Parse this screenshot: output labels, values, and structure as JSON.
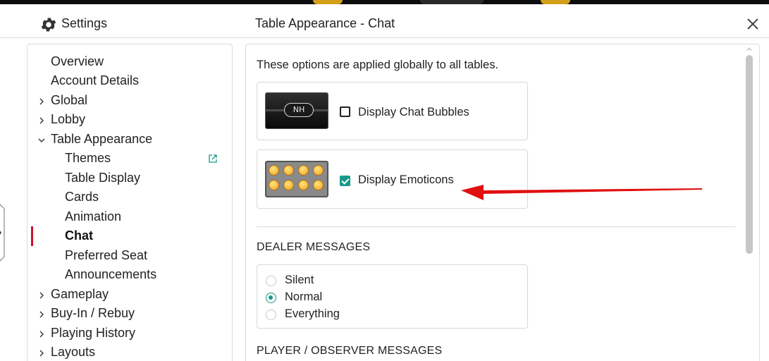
{
  "header": {
    "settings_label": "Settings",
    "page_title": "Table Appearance - Chat"
  },
  "sidebar": {
    "items": [
      {
        "label": "Overview",
        "level": 0,
        "chevron": "none"
      },
      {
        "label": "Account Details",
        "level": 0,
        "chevron": "none"
      },
      {
        "label": "Global",
        "level": 0,
        "chevron": "right"
      },
      {
        "label": "Lobby",
        "level": 0,
        "chevron": "right"
      },
      {
        "label": "Table Appearance",
        "level": 0,
        "chevron": "down"
      },
      {
        "label": "Themes",
        "level": 1,
        "external_link": true
      },
      {
        "label": "Table Display",
        "level": 1
      },
      {
        "label": "Cards",
        "level": 1
      },
      {
        "label": "Animation",
        "level": 1
      },
      {
        "label": "Chat",
        "level": 1,
        "active": true
      },
      {
        "label": "Preferred Seat",
        "level": 1
      },
      {
        "label": "Announcements",
        "level": 1
      },
      {
        "label": "Gameplay",
        "level": 0,
        "chevron": "right"
      },
      {
        "label": "Buy-In / Rebuy",
        "level": 0,
        "chevron": "right"
      },
      {
        "label": "Playing History",
        "level": 0,
        "chevron": "right"
      },
      {
        "label": "Layouts",
        "level": 0,
        "chevron": "right"
      }
    ]
  },
  "content": {
    "intro": "These options are applied globally to all tables.",
    "options": [
      {
        "label": "Display Chat Bubbles",
        "checked": false,
        "thumb_text": "NH"
      },
      {
        "label": "Display Emoticons",
        "checked": true
      }
    ],
    "dealer_messages": {
      "title": "DEALER MESSAGES",
      "choices": [
        "Silent",
        "Normal",
        "Everything"
      ],
      "selected": "Normal"
    },
    "player_messages": {
      "title": "PLAYER / OBSERVER MESSAGES"
    }
  },
  "colors": {
    "accent": "#169a8a",
    "active_marker": "#d0102b",
    "annotation_arrow": "#e01010"
  },
  "icons": [
    "gear-icon",
    "close-icon",
    "external-link-icon",
    "chevron-right-icon",
    "chevron-down-icon",
    "expand-panel-icon"
  ]
}
